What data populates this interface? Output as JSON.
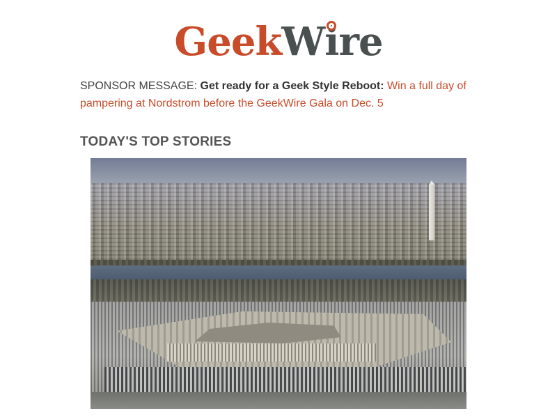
{
  "logo": {
    "part1": "Geek",
    "part2_before_i": "W",
    "part2_i": "i",
    "part2_after_i": "re"
  },
  "sponsor": {
    "label": "SPONSOR MESSAGE:",
    "headline": "Get ready for a Geek Style Reboot:",
    "link_text": "Win a full day of pampering at Nordstrom before the GeekWire Gala on Dec. 5"
  },
  "section": {
    "title": "TODAY'S TOP STORIES"
  },
  "colors": {
    "brand_orange": "#c84b2a",
    "brand_gray": "#4a4f4f",
    "text": "#444444"
  }
}
